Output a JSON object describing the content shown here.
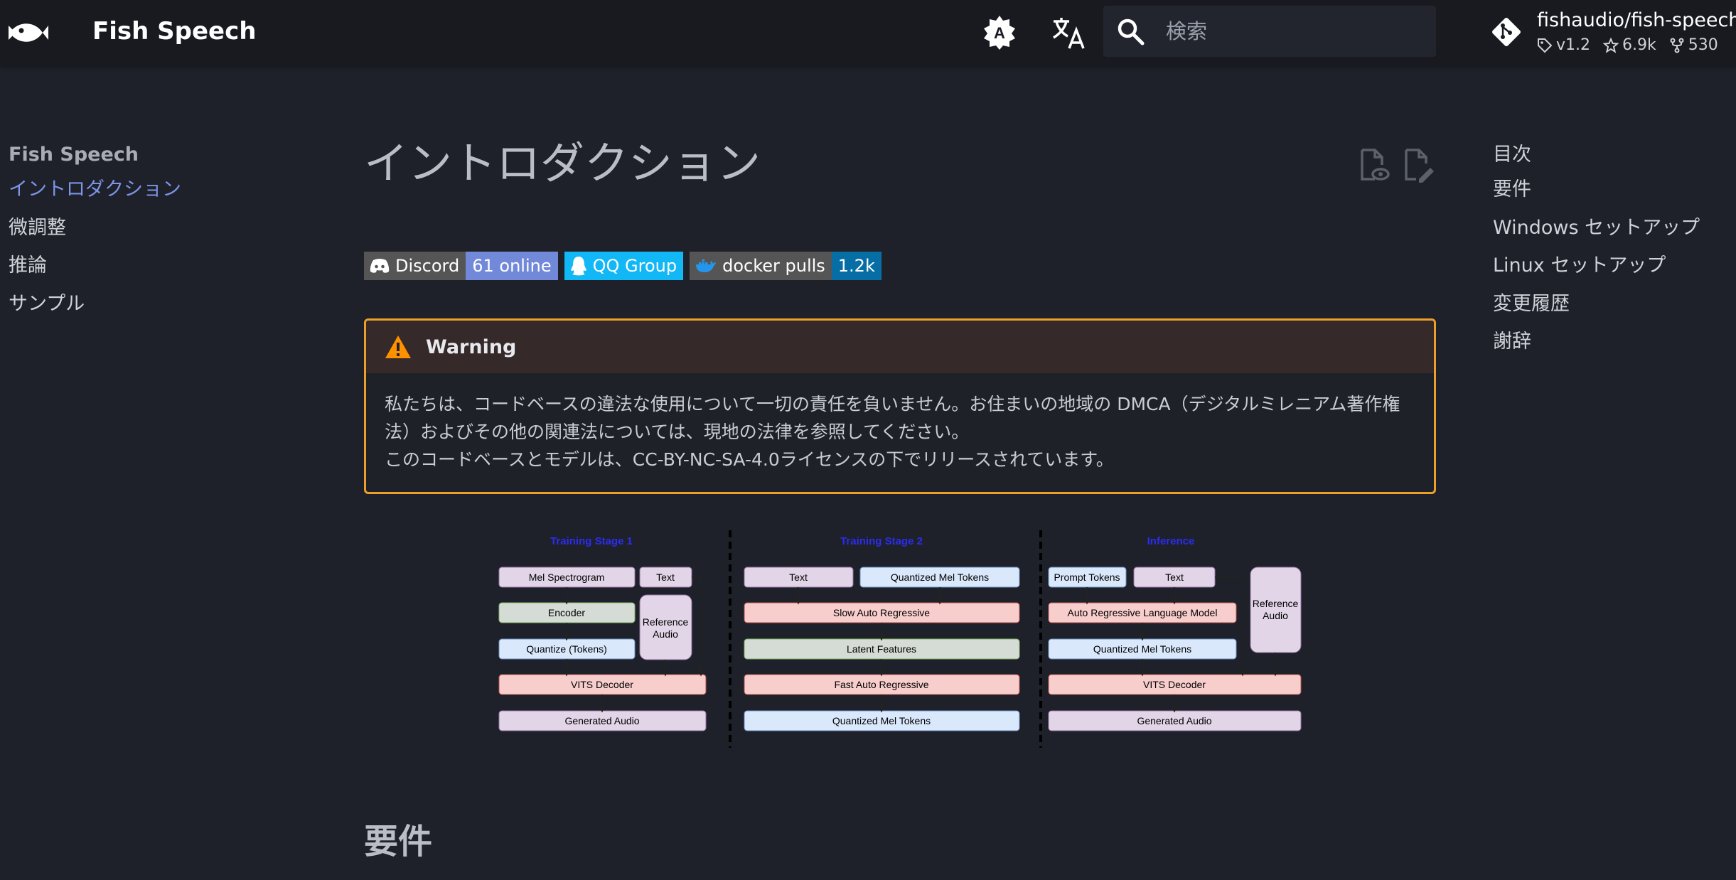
{
  "header": {
    "site_title": "Fish Speech",
    "search_placeholder": "検索",
    "repo": {
      "name": "fishaudio/fish-speech",
      "version": "v1.2",
      "stars": "6.9k",
      "forks": "530"
    },
    "icons": [
      "fish-logo-icon",
      "palette-toggle-icon",
      "translate-icon",
      "search-icon",
      "git-icon"
    ]
  },
  "nav": {
    "section": "Fish Speech",
    "items": [
      "イントロダクション",
      "微調整",
      "推論",
      "サンプル"
    ],
    "active_index": 0
  },
  "toc": {
    "title": "目次",
    "items": [
      "要件",
      "Windows セットアップ",
      "Linux セットアップ",
      "変更履歴",
      "謝辞"
    ]
  },
  "content": {
    "title": "イントロダクション",
    "badges": [
      {
        "label": "Discord",
        "value": "61 online",
        "label_color": "#555555",
        "value_color": "#7289da",
        "icon": "discord-icon"
      },
      {
        "label": "QQ Group",
        "value": "",
        "label_color": "#12b7f5",
        "value_color": "#12b7f5",
        "icon": "qq-icon"
      },
      {
        "label": "docker pulls",
        "value": "1.2k",
        "label_color": "#555555",
        "value_color": "#066da5",
        "icon": "docker-icon"
      }
    ],
    "warning": {
      "title": "Warning",
      "line1": "私たちは、コードベースの違法な使用について一切の責任を負いません。お住まいの地域の DMCA（デジタルミレニアム著作権法）およびその他の関連法については、現地の法律を参照してください。",
      "line2": "このコードベースとモデルは、CC-BY-NC-SA-4.0ライセンスの下でリリースされています。"
    },
    "diagram": {
      "stage1": {
        "title": "Training Stage 1",
        "mel": "Mel Spectrogram",
        "text": "Text",
        "encoder": "Encoder",
        "reference": [
          "Reference",
          "Audio"
        ],
        "quantize": "Quantize (Tokens)",
        "vits": "VITS Decoder",
        "generated": "Generated Audio"
      },
      "stage2": {
        "title": "Training Stage 2",
        "text": "Text",
        "qmel": "Quantized Mel Tokens",
        "slow": "Slow Auto Regressive",
        "latent": "Latent Features",
        "fast": "Fast Auto Regressive",
        "qmel_out": "Quantized Mel Tokens"
      },
      "inference": {
        "title": "Inference",
        "prompt": "Prompt Tokens",
        "text": "Text",
        "reference": [
          "Reference",
          "Audio"
        ],
        "arlm": "Auto Regressive Language Model",
        "qmel": "Quantized Mel Tokens",
        "vits": "VITS Decoder",
        "generated": "Generated Audio"
      }
    },
    "section2_title": "要件"
  },
  "colors": {
    "accent": "#7d94e8",
    "warning_border": "#ec9f2b",
    "diagram_title": "#2c2cf0",
    "box_purple": "#e1d5e7",
    "box_blue": "#dae8fc",
    "box_red": "#f8cecc",
    "box_gray": "#d5dbd5"
  }
}
